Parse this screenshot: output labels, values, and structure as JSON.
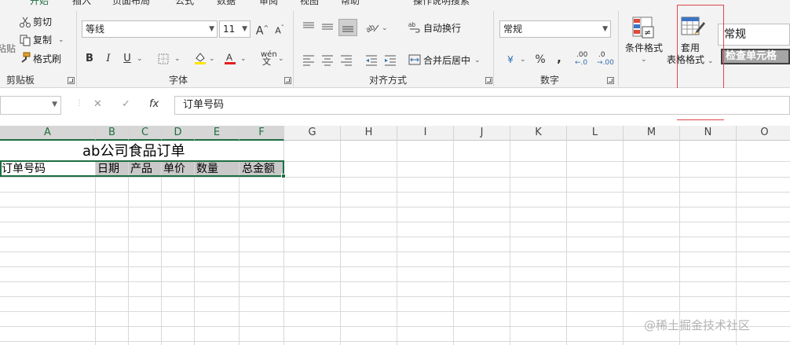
{
  "tabs": [
    "开始",
    "插入",
    "页面布局",
    "公式",
    "数据",
    "审阅",
    "视图",
    "帮助",
    "操作说明搜索"
  ],
  "clipboard": {
    "cut": "剪切",
    "copy": "复制",
    "format_painter": "格式刷",
    "paste": "粘贴",
    "label": "剪贴板"
  },
  "font": {
    "name": "等线",
    "size": "11",
    "bold": "B",
    "italic": "I",
    "underline": "U",
    "grow": "A",
    "shrink": "A",
    "phonetic": "wén",
    "label": "字体"
  },
  "alignment": {
    "wrap": "自动换行",
    "merge": "合并后居中",
    "label": "对齐方式"
  },
  "number": {
    "format": "常规",
    "currency": "¥",
    "percent": "%",
    "comma": ",",
    "inc_decimal": ".00",
    "dec_decimal": ".0",
    "label": "数字"
  },
  "styles": {
    "conditional": "条件格式",
    "table_format_line1": "套用",
    "table_format_line2": "表格格式",
    "cell_style": "常规",
    "check_cell": "检查单元格"
  },
  "formula_bar": {
    "cancel": "✕",
    "enter": "✓",
    "fx": "fx",
    "value": "订单号码"
  },
  "columns": [
    "A",
    "B",
    "C",
    "D",
    "E",
    "F",
    "G",
    "H",
    "I",
    "J",
    "K",
    "L",
    "M",
    "N",
    "O"
  ],
  "sheet": {
    "title": "ab公司食品订单",
    "headers": [
      "订单号码",
      "日期",
      "产品",
      "单价",
      "数量",
      "总金额"
    ]
  },
  "colors": {
    "accent": "#1e6e42",
    "header_fill": "#c9c9c9",
    "highlight_box": "#e0454a",
    "font_red": "#e02020",
    "fill_yellow": "#ffe600"
  },
  "watermark": "@稀土掘金技术社区"
}
